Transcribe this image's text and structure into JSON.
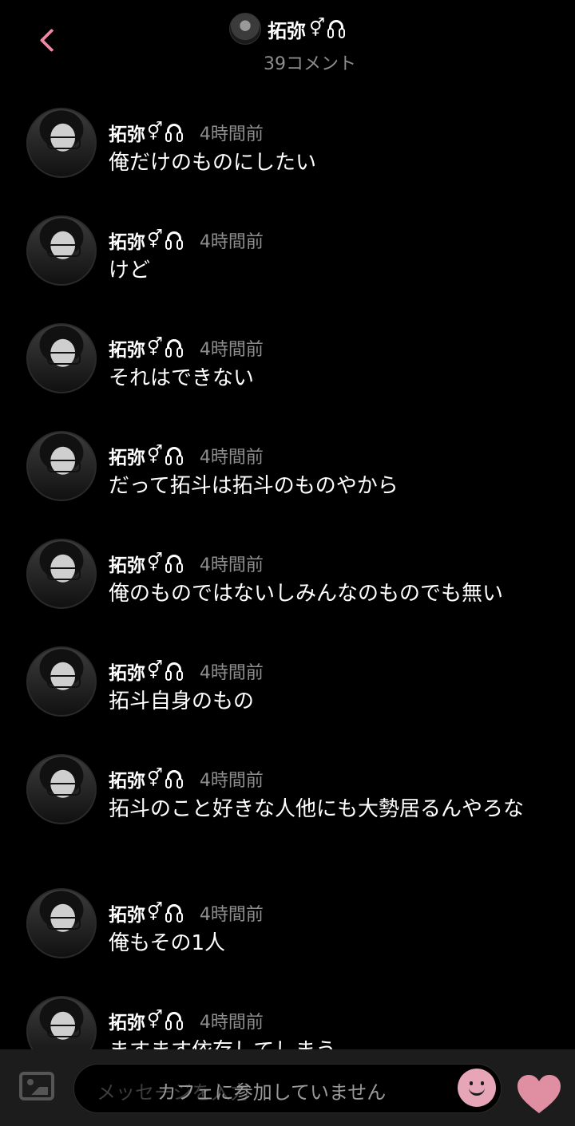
{
  "header": {
    "back_icon": "chevron-left-icon",
    "user_name": "拓弥",
    "gender_symbol": "⚥",
    "headphones_icon": "headphones-icon",
    "comment_count": "39コメント"
  },
  "comments": [
    {
      "name": "拓弥",
      "time": "4時間前",
      "text": "俺だけのものにしたい"
    },
    {
      "name": "拓弥",
      "time": "4時間前",
      "text": "けど"
    },
    {
      "name": "拓弥",
      "time": "4時間前",
      "text": "それはできない"
    },
    {
      "name": "拓弥",
      "time": "4時間前",
      "text": "だって拓斗は拓斗のものやから"
    },
    {
      "name": "拓弥",
      "time": "4時間前",
      "text": "俺のものではないしみんなのものでも無い"
    },
    {
      "name": "拓弥",
      "time": "4時間前",
      "text": "拓斗自身のもの"
    },
    {
      "name": "拓弥",
      "time": "4時間前",
      "text": "拓斗のこと好きな人他にも大勢居るんやろな"
    },
    {
      "name": "拓弥",
      "time": "4時間前",
      "text": "俺もその1人"
    },
    {
      "name": "拓弥",
      "time": "4時間前",
      "text": "ますます依存してしまう"
    }
  ],
  "composer": {
    "image_icon": "image-icon",
    "placeholder": "メッセージを入力",
    "notice": "カフェに参加していません",
    "emoji_icon": "emoji-icon",
    "heart_icon": "heart-icon"
  },
  "colors": {
    "accent_pink": "#e88aa4",
    "emoji_pink": "#e6a6b8",
    "heart_pink": "#e08fa3",
    "muted_text": "#8e8e8e"
  }
}
